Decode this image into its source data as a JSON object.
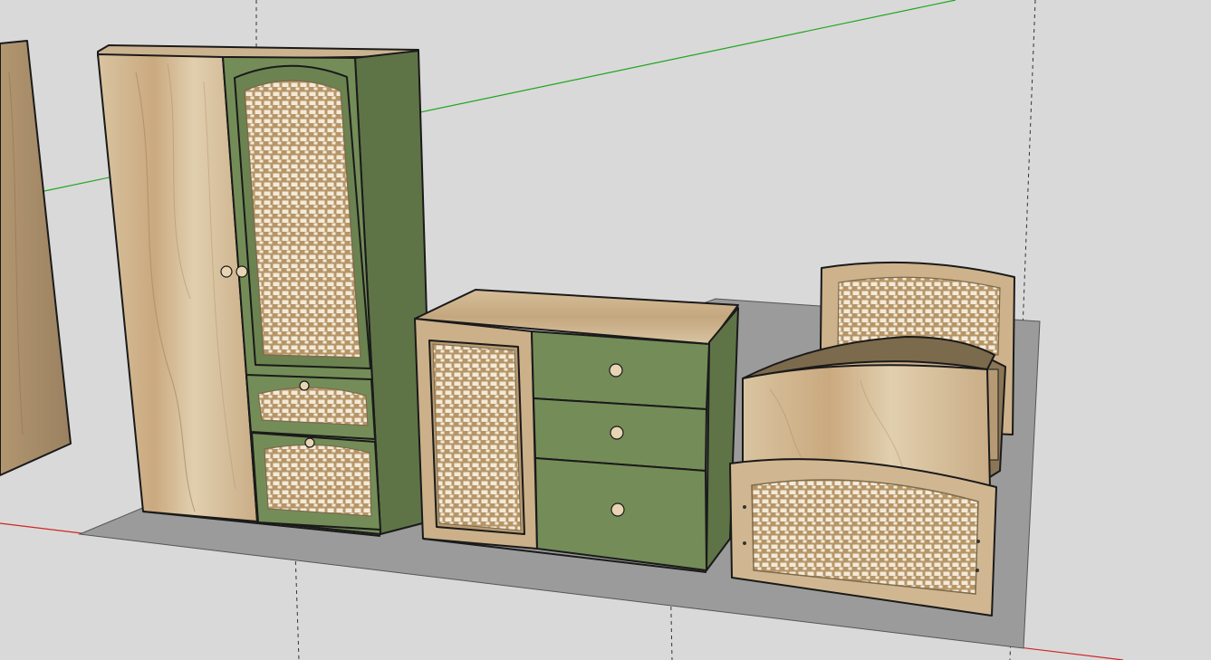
{
  "viewport": {
    "label": "",
    "background": "#d9d9d9"
  },
  "colors": {
    "ground": "#9b9b9b",
    "oak_light": "#d8c3a0",
    "oak_mid": "#c8ae86",
    "oak_dark": "#a58b64",
    "green_front": "#748d58",
    "green_side": "#5e7446",
    "cane_hole": "#f3ead9",
    "axis_red": "#d22424",
    "axis_green": "#1fa51f",
    "edge": "#1a1a1a"
  },
  "icons": {
    "knob": "round-knob-icon"
  }
}
